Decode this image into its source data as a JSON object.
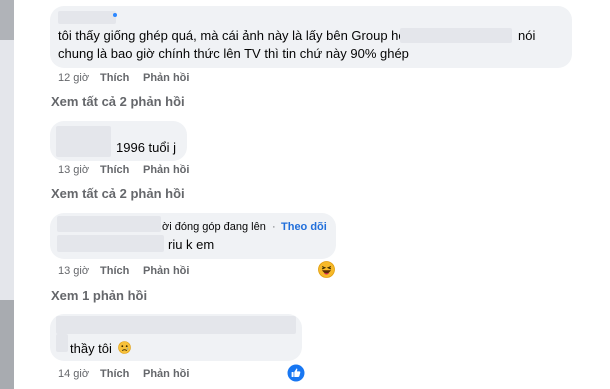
{
  "comments": [
    {
      "line1": "tôi thấy giống ghép quá, mà cái ảnh này là lấy bên Group hội",
      "line1_end": "nói",
      "line2": "chung là bao giờ chính thức lên TV thì tin chứ này 90% ghép",
      "time": "12 giờ",
      "like": "Thích",
      "reply": "Phản hồi",
      "view_replies": "Xem tất cả 2 phản hồi"
    },
    {
      "line1": "1996 tuổi j",
      "time": "13 giờ",
      "like": "Thích",
      "reply": "Phản hồi",
      "view_replies": "Xem tất cả 2 phản hồi"
    },
    {
      "badge": "ời đóng góp đang lên",
      "separator": "·",
      "follow": "Theo dõi",
      "line1": "riu k em",
      "time": "13 giờ",
      "like": "Thích",
      "reply": "Phản hồi",
      "reaction": "haha-icon",
      "view_replies": "Xem 1 phản hồi"
    },
    {
      "line1": "thầy tôi",
      "time": "14 giờ",
      "like": "Thích",
      "reply": "Phản hồi",
      "reaction": "like-icon"
    }
  ]
}
